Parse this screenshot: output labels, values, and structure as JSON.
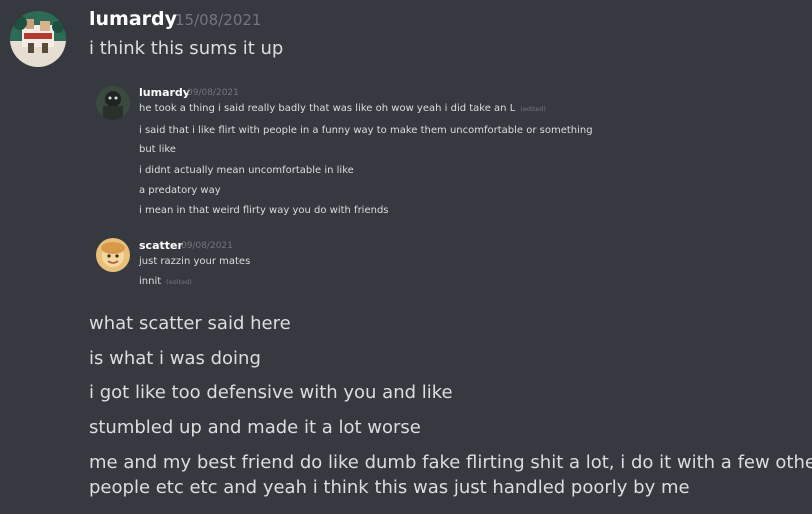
{
  "main_message": {
    "username": "lumardy",
    "timestamp": "15/08/2021",
    "first_line": "i think this sums it up",
    "after_lines": [
      "what scatter said here",
      "is what i was doing",
      "i got like too defensive with you and like",
      "stumbled up and made it a lot worse",
      "me and my best friend do like dumb fake flirting shit a lot, i do it with a few other",
      "people etc etc and yeah i think this was just handled poorly by me"
    ]
  },
  "embedded": {
    "message_1": {
      "username": "lumardy",
      "timestamp": "09/08/2021",
      "edited_label": "(edited)",
      "lines": [
        "he took a thing i said really badly that was like oh wow yeah i did take an L",
        "i said that i like flirt with people in a funny way to make them uncomfortable or something",
        "but like",
        "i didnt actually mean uncomfortable in like",
        "a predatory way",
        "i mean in that weird flirty way you do with friends"
      ]
    },
    "message_2": {
      "username": "scatter",
      "timestamp": "09/08/2021",
      "edited_label": "(edited)",
      "lines": [
        "just razzin your mates",
        "innit"
      ]
    }
  },
  "colors": {
    "background": "#36393f",
    "username": "#ffffff",
    "text": "#dcddde",
    "muted": "#72767d"
  }
}
